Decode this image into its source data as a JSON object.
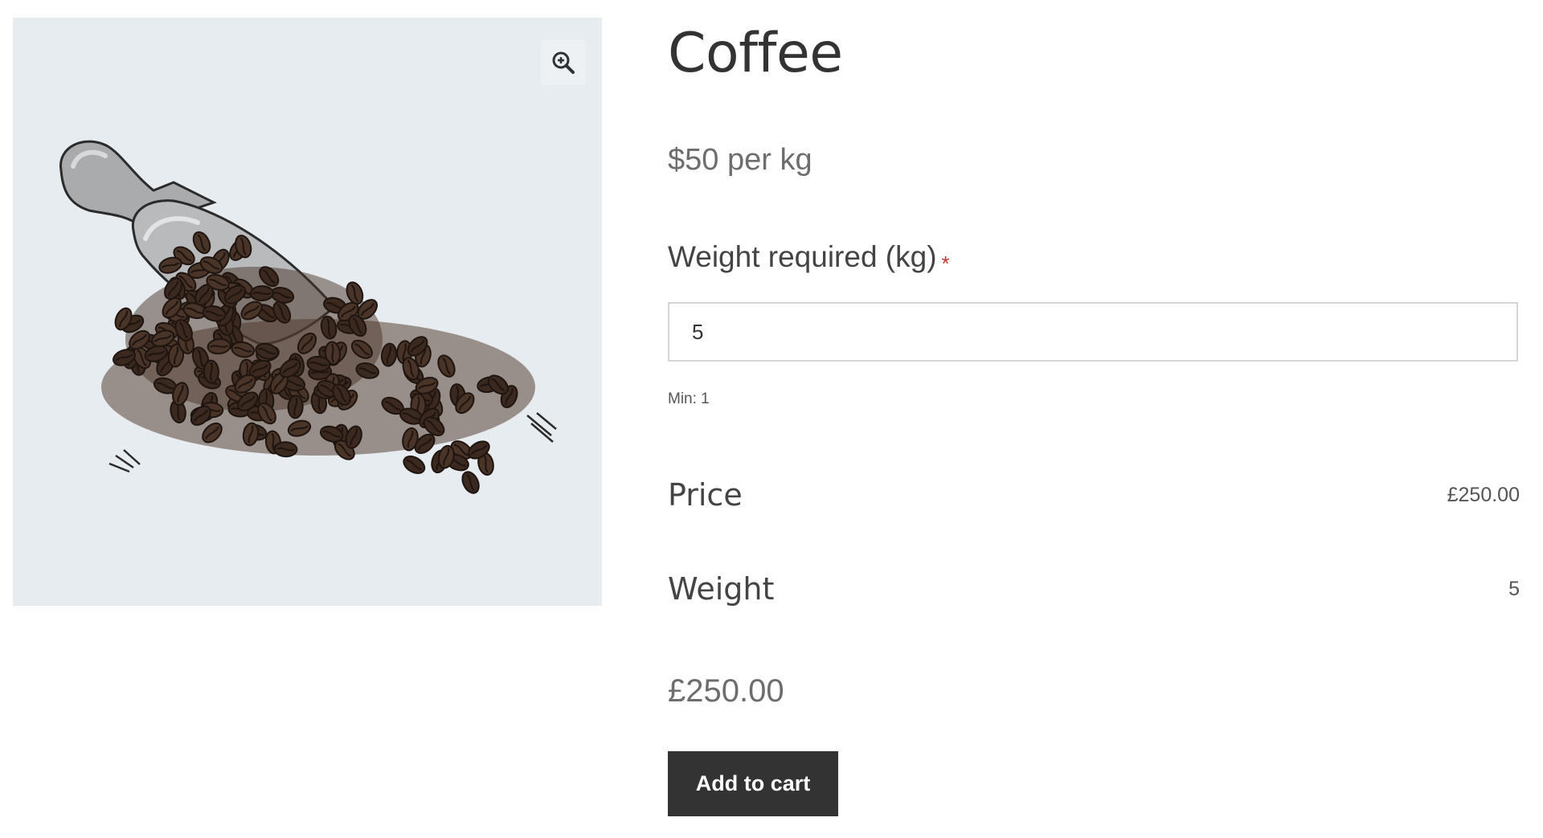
{
  "product": {
    "title": "Coffee",
    "unit_price": "$50 per kg",
    "image_alt_icon": "coffee-scoop-illustration",
    "zoom_icon": "zoom-in-icon"
  },
  "weight_field": {
    "label": "Weight required (kg)",
    "required_marker": "*",
    "value": "5",
    "hint": "Min: 1"
  },
  "summary_rows": {
    "price_label": "Price",
    "price_value": "£250.00",
    "weight_label": "Weight",
    "weight_value": "5"
  },
  "total": "£250.00",
  "cart": {
    "add_label": "Add to cart"
  },
  "colors": {
    "image_background": "#e7ecf0",
    "button_background": "#333333",
    "required_marker": "#c0392b"
  }
}
